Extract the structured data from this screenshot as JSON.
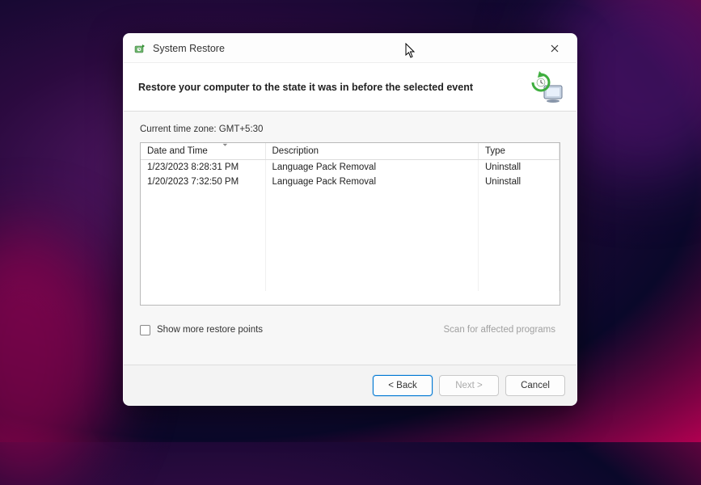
{
  "window": {
    "title": "System Restore"
  },
  "banner": {
    "heading": "Restore your computer to the state it was in before the selected event"
  },
  "timezone_label": "Current time zone: GMT+5:30",
  "table": {
    "headers": {
      "datetime": "Date and Time",
      "description": "Description",
      "type": "Type"
    },
    "rows": [
      {
        "datetime": "1/23/2023 8:28:31 PM",
        "description": "Language Pack Removal",
        "type": "Uninstall"
      },
      {
        "datetime": "1/20/2023 7:32:50 PM",
        "description": "Language Pack Removal",
        "type": "Uninstall"
      }
    ]
  },
  "checkbox": {
    "label": "Show more restore points",
    "checked": false
  },
  "scan_button_label": "Scan for affected programs",
  "footer": {
    "back": "< Back",
    "next": "Next >",
    "cancel": "Cancel"
  }
}
